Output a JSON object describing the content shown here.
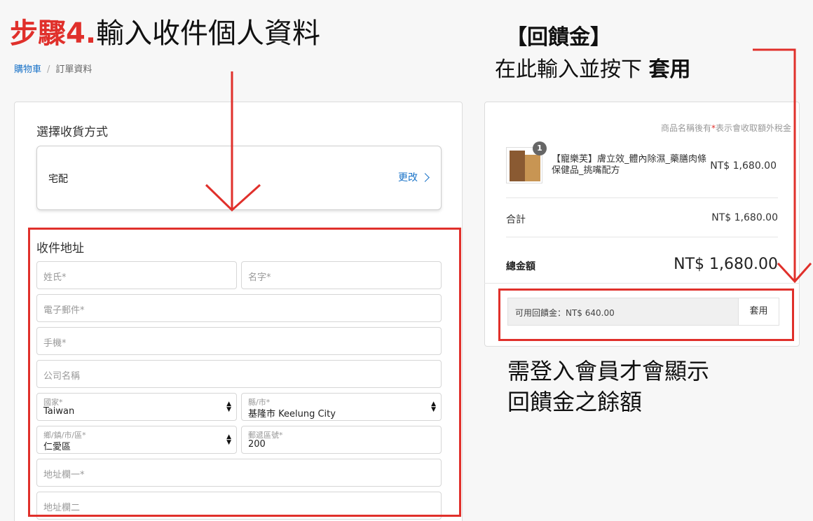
{
  "annotations": {
    "step_number": "步驟4.",
    "step_text": "輸入收件個人資料",
    "rebate_title": "【回饋金】",
    "rebate_instruction": "在此輸入並按下",
    "rebate_instruction_bold": "套用",
    "login_note_line1": "需登入會員才會顯示",
    "login_note_line2": "回饋金之餘額",
    "accent_color": "#e0302b"
  },
  "breadcrumb": {
    "cart": "購物車",
    "separator": "/",
    "current": "訂單資料"
  },
  "shipping": {
    "title": "選擇收貨方式",
    "method": "宅配",
    "change_label": "更改"
  },
  "address": {
    "title": "收件地址",
    "last_name_placeholder": "姓氏*",
    "first_name_placeholder": "名字*",
    "email_placeholder": "電子郵件*",
    "phone_placeholder": "手機*",
    "company_placeholder": "公司名稱",
    "country_label": "國家*",
    "country_value": "Taiwan",
    "city_label": "縣/市*",
    "city_value": "基隆市 Keelung City",
    "district_label": "鄉/鎮/市/區*",
    "district_value": "仁愛區",
    "zip_label": "郵遞區號*",
    "zip_value": "200",
    "address1_placeholder": "地址欄一*",
    "address2_placeholder": "地址欄二"
  },
  "summary": {
    "tax_note_prefix": "商品名稱後有",
    "tax_note_star": "*",
    "tax_note_suffix": "表示會收取額外稅金",
    "product_qty": "1",
    "product_name": "【寵樂芙】膚立效_體內除濕_藥膳肉條 保健品_挑嘴配方",
    "product_price": "NT$ 1,680.00",
    "subtotal_label": "合計",
    "subtotal_value": "NT$ 1,680.00",
    "total_label": "總金額",
    "total_value": "NT$ 1,680.00",
    "credit_text": "可用回饋金：NT$ 640.00",
    "apply_label": "套用"
  }
}
